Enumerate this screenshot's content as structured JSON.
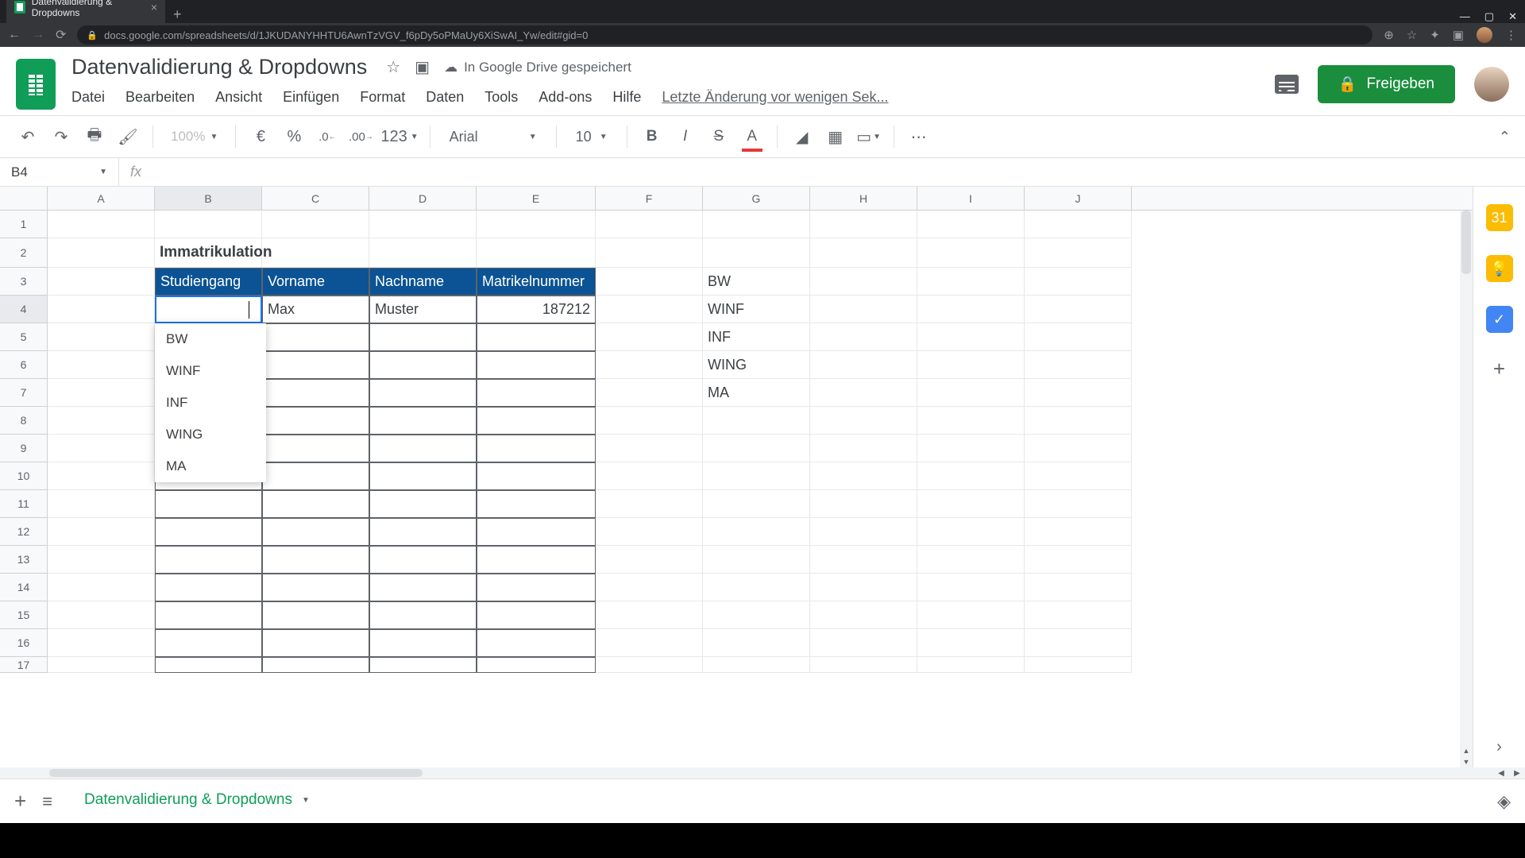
{
  "browser": {
    "tab_title": "Datenvalidierung & Dropdowns",
    "url": "docs.google.com/spreadsheets/d/1JKUDANYHHTU6AwnTzVGV_f6pDy5oPMaUy6XiSwAI_Yw/edit#gid=0"
  },
  "doc": {
    "title": "Datenvalidierung & Dropdowns",
    "saved_status": "In Google Drive gespeichert",
    "share_label": "Freigeben",
    "last_edit": "Letzte Änderung vor wenigen Sek..."
  },
  "menu": {
    "file": "Datei",
    "edit": "Bearbeiten",
    "view": "Ansicht",
    "insert": "Einfügen",
    "format": "Format",
    "data": "Daten",
    "tools": "Tools",
    "addons": "Add-ons",
    "help": "Hilfe"
  },
  "toolbar": {
    "zoom": "100%",
    "currency": "€",
    "percent": "%",
    "dec_less": ".0",
    "dec_more": ".00",
    "numfmt": "123",
    "font": "Arial",
    "size": "10"
  },
  "name_box": "B4",
  "columns": [
    "A",
    "B",
    "C",
    "D",
    "E",
    "F",
    "G",
    "H",
    "I",
    "J"
  ],
  "rows": [
    "1",
    "2",
    "3",
    "4",
    "5",
    "6",
    "7",
    "8",
    "9",
    "10",
    "11",
    "12",
    "13",
    "14",
    "15",
    "16",
    "17"
  ],
  "table": {
    "title": "Immatrikulation",
    "headers": [
      "Studiengang",
      "Vorname",
      "Nachname",
      "Matrikelnummer"
    ],
    "row4": {
      "vorname": "Max",
      "nachname": "Muster",
      "matrikel": "187212"
    }
  },
  "list_g": [
    "BW",
    "WINF",
    "INF",
    "WING",
    "MA"
  ],
  "dropdown_options": [
    "BW",
    "WINF",
    "INF",
    "WING",
    "MA"
  ],
  "sheet_tab": "Datenvalidierung & Dropdowns"
}
